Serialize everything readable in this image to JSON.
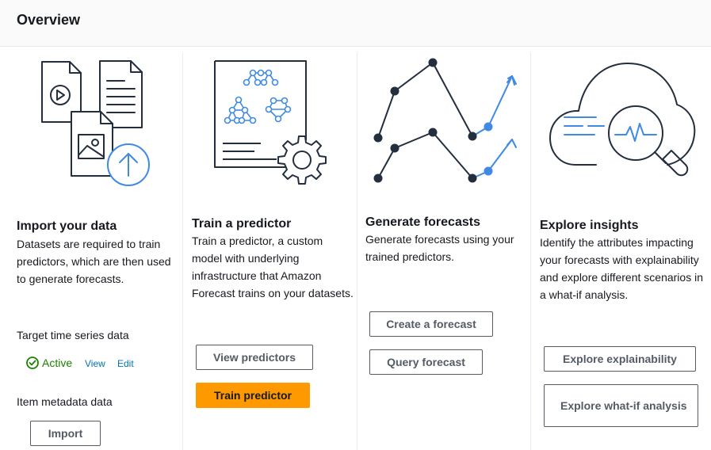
{
  "header": {
    "title": "Overview"
  },
  "import_data": {
    "title": "Import your data",
    "description": "Datasets are required to train predictors, which are then used to generate forecasts.",
    "target_label": "Target time series data",
    "status": "Active",
    "view_link": "View",
    "edit_link": "Edit",
    "item_metadata_label": "Item metadata data",
    "import_button": "Import"
  },
  "train_predictor": {
    "title": "Train a predictor",
    "description": "Train a predictor, a custom model with underlying infrastructure that Amazon Forecast trains on your datasets.",
    "view_button": "View predictors",
    "train_button": "Train predictor"
  },
  "generate_forecasts": {
    "title": "Generate forecasts",
    "description": "Generate forecasts using your trained predictors.",
    "create_button": "Create a forecast",
    "query_button": "Query forecast"
  },
  "explore_insights": {
    "title": "Explore insights",
    "description": "Identify the attributes impacting your forecasts with explainability and explore different scenarios in a what-if analysis.",
    "explainability_button": "Explore explainability",
    "whatif_button": "Explore what-if analysis"
  },
  "colors": {
    "primary": "#ff9900",
    "accent_blue": "#3f8ae2",
    "link": "#0073bb",
    "success": "#1d8102",
    "illustration_stroke": "#232f3e"
  },
  "icons": [
    "document-video-icon",
    "document-text-icon",
    "document-image-icon",
    "upload-icon",
    "network-document-icon",
    "gear-icon",
    "line-chart-icon",
    "cloud-icon",
    "magnifier-pulse-icon",
    "check-circle-icon"
  ]
}
